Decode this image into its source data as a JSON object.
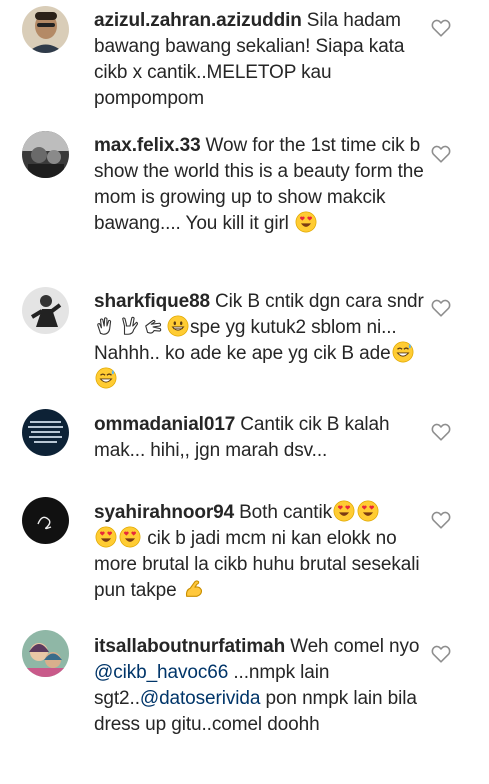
{
  "comments": [
    {
      "username": "azizul.zahran.azizuddin",
      "text": "Sila hadam bawang bawang sekalian! Siapa kata cikb x cantik..MELETOP kau pompompom"
    },
    {
      "username": "max.felix.33",
      "text": "Wow for the 1st time cik b show the world this is a beauty form the mom is growing up to show makcik bawang.... You kill it girl"
    },
    {
      "username": "sharkfique88",
      "text_a": "Cik B cntik dgn cara sndr",
      "text_b": "spe yg kutuk2 sblom ni... Nahhh.. ko ade ke ape yg cik B ade"
    },
    {
      "username": "ommadanial017",
      "text": "Cantik cik B kalah mak... hihi,, jgn marah dsv..."
    },
    {
      "username": "syahirahnoor94",
      "text_a": "Both cantik",
      "text_b": "cik b jadi mcm ni kan elokk no more brutal la cikb huhu brutal sesekali pun takpe"
    },
    {
      "username": "itsallaboutnurfatimah",
      "text_a": "Weh comel nyo",
      "mention_1": "@cikb_havoc66",
      "text_b": "...nmpk lain sgt2..",
      "mention_2": "@datoserivida",
      "text_c": "pon nmpk lain bila dress up gitu..comel doohh"
    }
  ],
  "icons": {
    "like": "heart-outline-icon",
    "emoji_heart_eyes": "heart-eyes-emoji",
    "emoji_clap": "clapping-hands-emoji",
    "emoji_love_you": "love-you-gesture-emoji",
    "emoji_pinch": "pinching-hand-emoji",
    "emoji_grin": "grinning-face-emoji",
    "emoji_sweat_smile": "grinning-sweat-emoji",
    "emoji_flex": "flexed-biceps-emoji"
  },
  "colors": {
    "text": "#262626",
    "mention": "#003569",
    "icon": "#8e8e8e"
  }
}
